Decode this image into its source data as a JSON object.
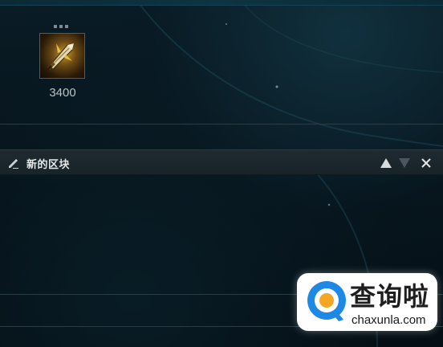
{
  "item": {
    "icon": "sword-item-icon",
    "price": "3400"
  },
  "block": {
    "title": "新的区块",
    "edit_icon": "pencil-icon",
    "move_up_icon": "triangle-up-icon",
    "move_down_icon": "triangle-down-icon",
    "close_icon": "close-icon"
  },
  "watermark": {
    "logo_icon": "magnifier-logo-icon",
    "title": "查询啦",
    "domain": "chaxunla.com"
  },
  "colors": {
    "background": "#06121a",
    "header_bg": "#1e2a30",
    "text_primary": "#e4e8ea",
    "text_price": "#b8c2c6",
    "logo_blue": "#1e88e5",
    "logo_orange": "#f5a623"
  }
}
